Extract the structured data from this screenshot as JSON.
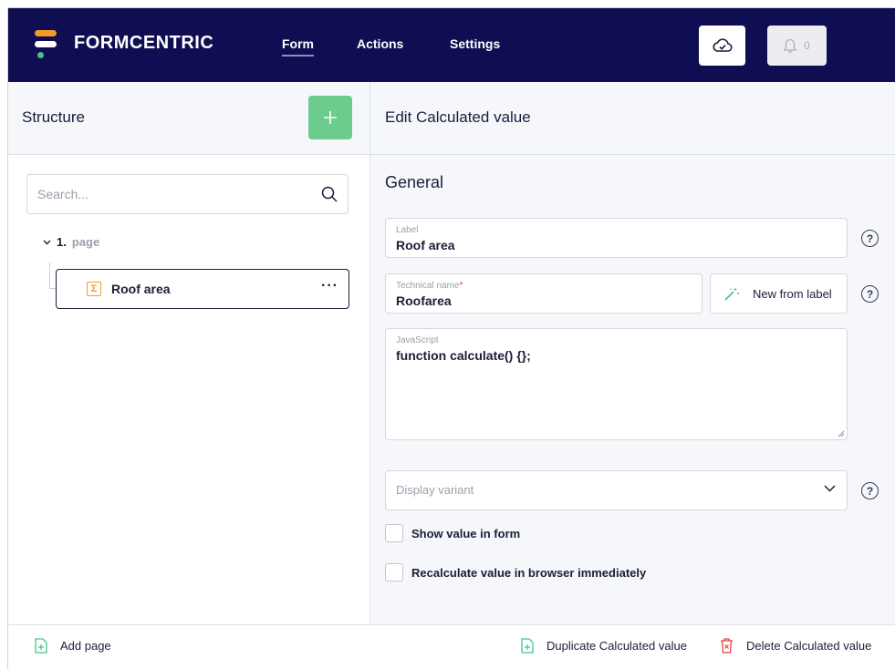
{
  "header": {
    "brand": "FORMCENTRIC",
    "nav": [
      "Form",
      "Actions",
      "Settings"
    ],
    "active_nav": "Form",
    "notification_count": "0",
    "colors": {
      "background": "#0f0e52",
      "logo_orange": "#f39a2a",
      "logo_green": "#47c48a"
    }
  },
  "sidebar": {
    "title": "Structure",
    "add_icon": "plus-icon",
    "search_placeholder": "Search...",
    "tree": {
      "page_number": "1.",
      "page_name": "page",
      "items": [
        {
          "label": "Roof area",
          "icon": "sigma-icon",
          "menu": "···"
        }
      ]
    }
  },
  "editor": {
    "title": "Edit Calculated value",
    "section": "General",
    "fields": {
      "label": {
        "label": "Label",
        "value": "Roof area"
      },
      "technical_name": {
        "label": "Technical name",
        "required_mark": "*",
        "value": "Roofarea"
      },
      "new_from_label": "New from label",
      "javascript": {
        "label": "JavaScript",
        "value": "function calculate() {};"
      },
      "display_variant": {
        "placeholder": "Display variant"
      }
    },
    "help_glyph": "?",
    "checkboxes": [
      {
        "label": "Show value in form",
        "checked": false
      },
      {
        "label": "Recalculate value in browser immediately",
        "checked": false
      }
    ]
  },
  "footer": {
    "add_page": "Add page",
    "duplicate": "Duplicate Calculated value",
    "delete": "Delete Calculated value",
    "colors": {
      "add": "#47c48a",
      "delete": "#e0453d"
    }
  }
}
